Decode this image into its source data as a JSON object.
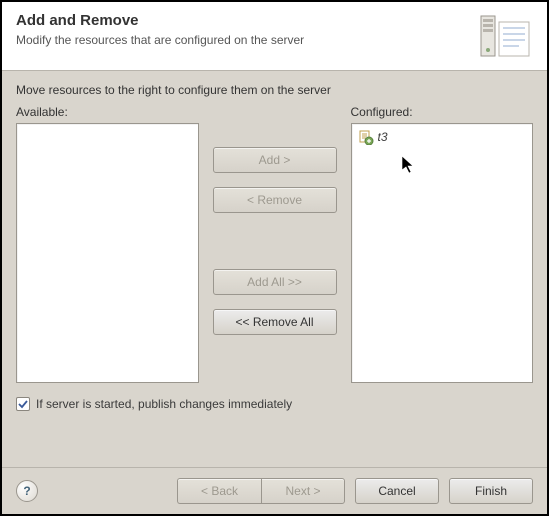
{
  "header": {
    "title": "Add and Remove",
    "subtitle": "Modify the resources that are configured on the server"
  },
  "instruction": "Move resources to the right to configure them on the server",
  "labels": {
    "available": "Available:",
    "configured": "Configured:"
  },
  "available_items": [],
  "configured_items": [
    {
      "label": "t3"
    }
  ],
  "buttons": {
    "add": "Add >",
    "remove": "< Remove",
    "add_all": "Add All >>",
    "remove_all": "<< Remove All"
  },
  "checkbox": {
    "publish_label": "If server is started, publish changes immediately",
    "checked": true
  },
  "footer": {
    "back": "< Back",
    "next": "Next >",
    "cancel": "Cancel",
    "finish": "Finish",
    "help": "?"
  }
}
